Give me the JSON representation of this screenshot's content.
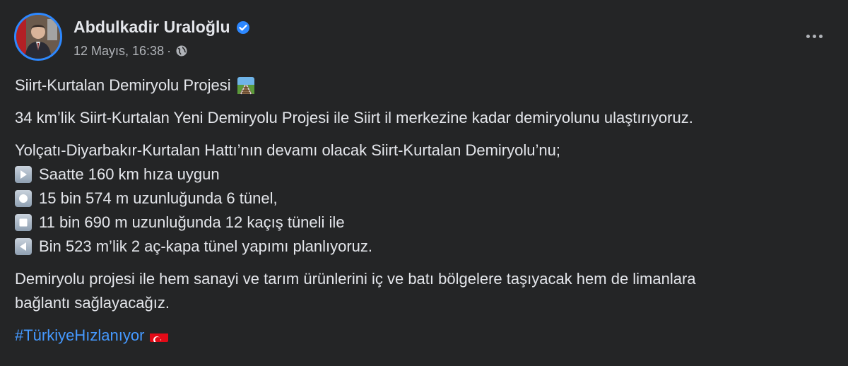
{
  "author": {
    "name": "Abdulkadir Uraloğlu",
    "date": "12 Mayıs, 16:38",
    "separator": "·"
  },
  "post": {
    "title": "Siirt-Kurtalan Demiryolu Projesi",
    "paragraph1": "34 km’lik Siirt-Kurtalan Yeni Demiryolu Projesi ile Siirt il merkezine kadar demiryolunu ulaştırıyoruz.",
    "intro": "Yolçatı-Diyarbakır-Kurtalan Hattı’nın devamı olacak Siirt-Kurtalan Demiryolu’nu;",
    "bullets": [
      "Saatte 160 km hıza uygun",
      "15 bin 574 m uzunluğunda 6 tünel,",
      "11 bin 690 m uzunluğunda 12 kaçış tüneli ile",
      "Bin 523 m’lik 2 aç-kapa tünel yapımı planlıyoruz."
    ],
    "paragraph3_line1": "Demiryolu projesi ile hem sanayi ve tarım ürünlerini iç ve batı bölgelere taşıyacak hem de limanlara",
    "paragraph3_line2": "bağlantı sağlayacağız.",
    "hashtag": "#TürkiyeHızlanıyor"
  },
  "icons": {
    "verified": "verified-badge-icon",
    "privacy": "globe-icon",
    "more": "more-options-icon",
    "title_emoji": "railway-track-emoji",
    "bullet_1": "play-button-emoji",
    "bullet_2": "record-button-emoji",
    "bullet_3": "stop-button-emoji",
    "bullet_4": "reverse-button-emoji",
    "flag": "turkey-flag-emoji"
  },
  "colors": {
    "background": "#242526",
    "text": "#e4e6eb",
    "secondary_text": "#b0b3b8",
    "link": "#4599ff",
    "verified": "#2d88ff"
  }
}
